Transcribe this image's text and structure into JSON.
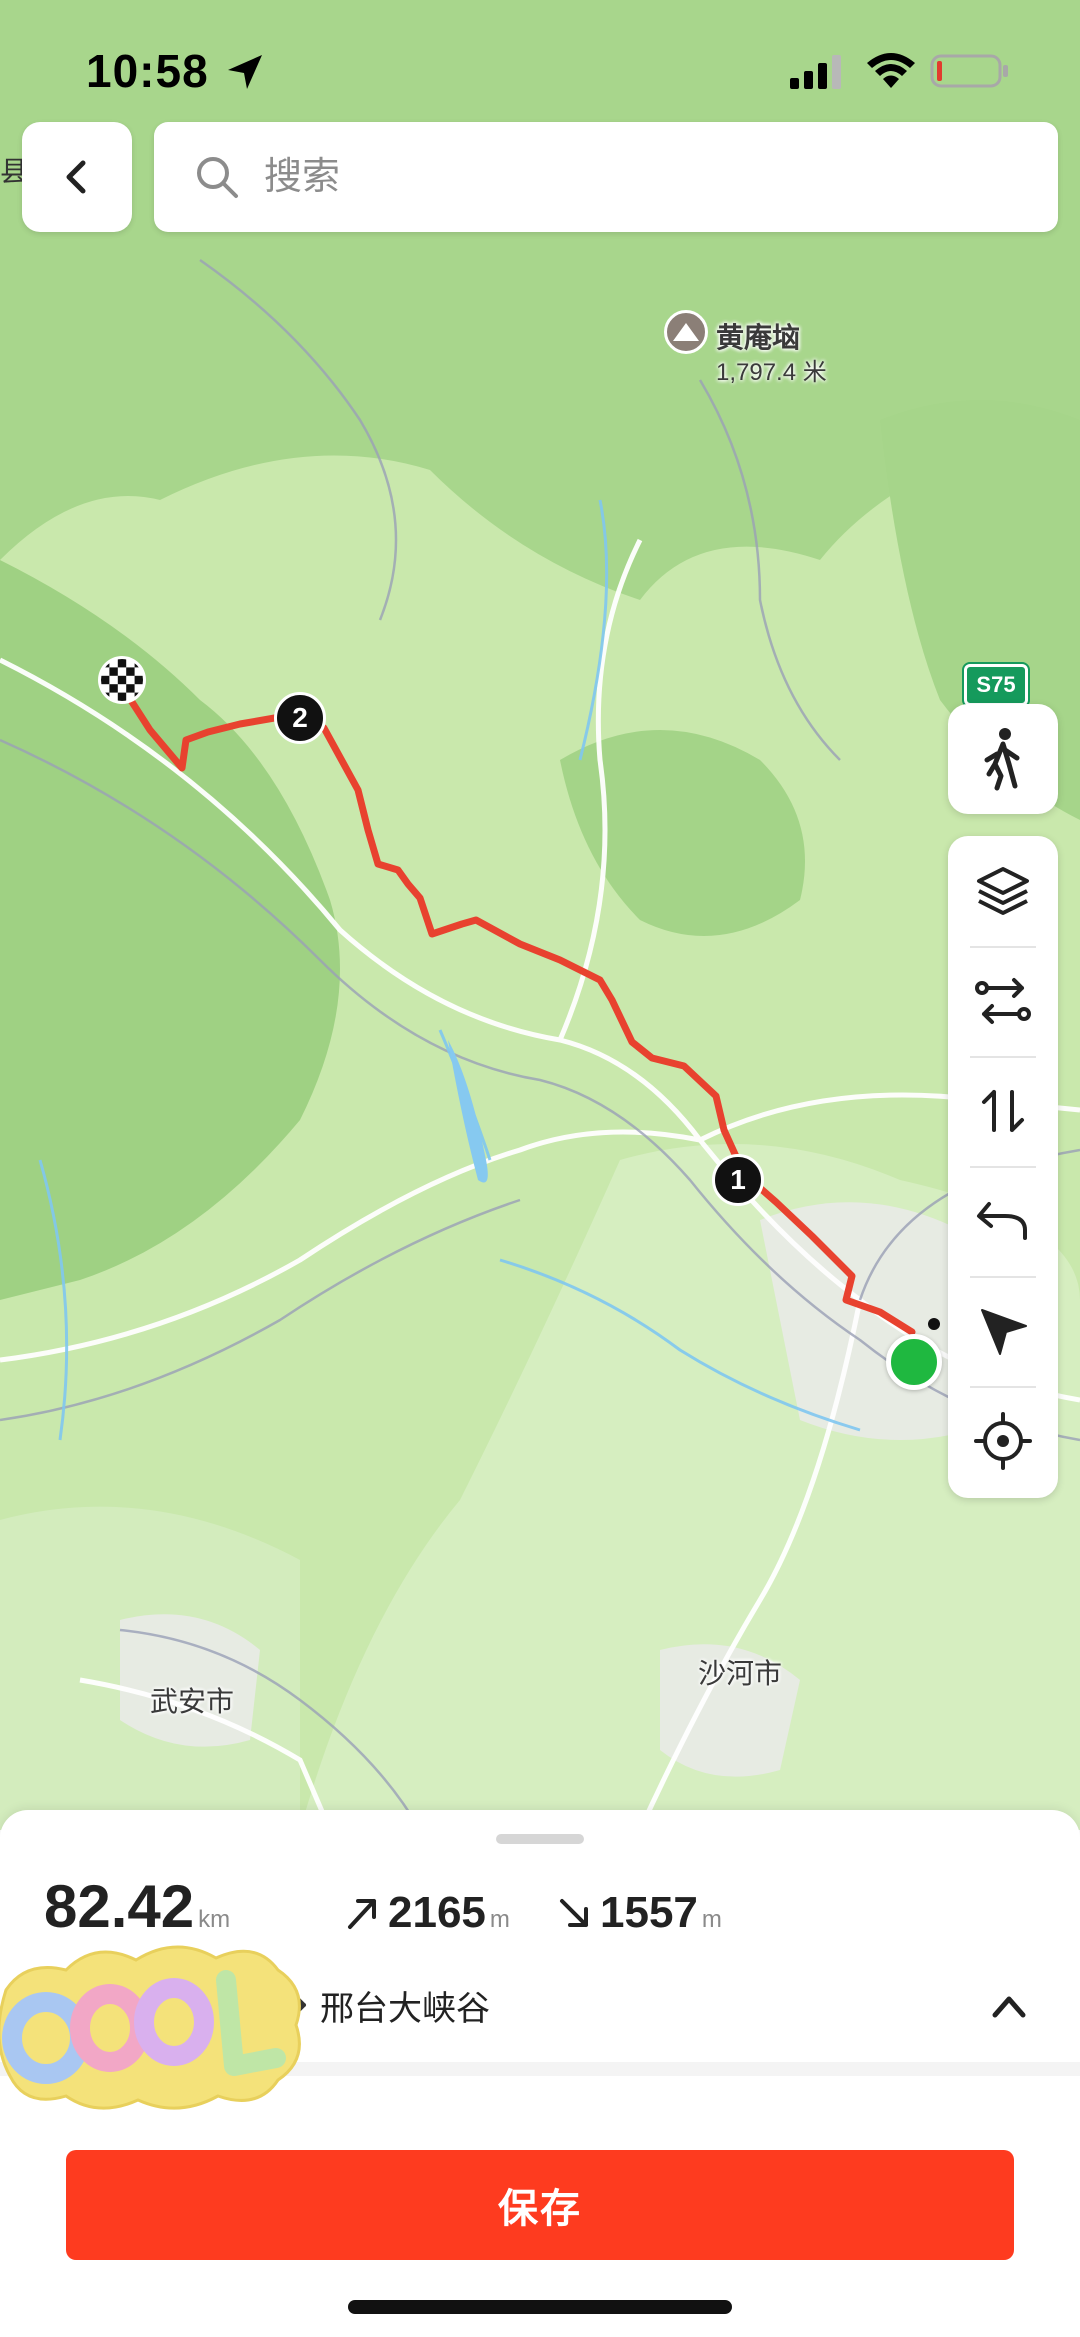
{
  "status_bar": {
    "time": "10:58",
    "icons": [
      "location-arrow-icon",
      "cellular-signal-icon",
      "wifi-icon",
      "battery-low-icon"
    ],
    "battery_color": "#e23b2e"
  },
  "search": {
    "placeholder": "搜索"
  },
  "map": {
    "peak": {
      "name": "黄庵垴",
      "elevation": "1,797.4 米"
    },
    "road_badge": "S75",
    "cities": [
      "武安市",
      "沙河市"
    ],
    "edge_label": "县",
    "waypoints": [
      "1",
      "2"
    ],
    "route_color": "#e8422f",
    "start_color": "#1fb840",
    "end_icon": "checkered-flag-icon"
  },
  "toolbar": {
    "buttons": [
      "walk-mode-icon",
      "layers-icon",
      "route-swap-icon",
      "reverse-icon",
      "undo-icon",
      "navigate-icon",
      "locate-icon"
    ]
  },
  "summary": {
    "distance": "82.42",
    "distance_unit": "km",
    "ascent": "2165",
    "ascent_unit": "m",
    "descent": "1557",
    "descent_unit": "m",
    "destination": "邢台大峡谷"
  },
  "sticker": {
    "text": "COOL"
  },
  "actions": {
    "save_label": "保存",
    "accent": "#fe3b1f"
  }
}
